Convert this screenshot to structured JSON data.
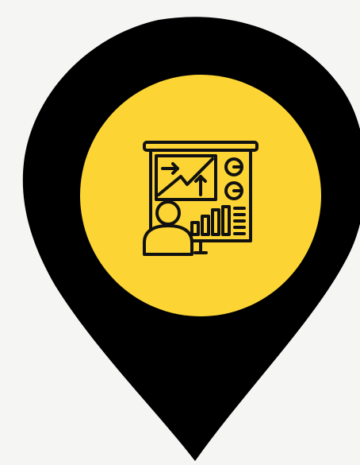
{
  "graphic": {
    "pin_icon": "map-pin-icon",
    "presentation_icon": "presentation-board-icon",
    "colors": {
      "background": "#f5f5f4",
      "pin": "#000000",
      "circle": "#fcd535",
      "icon_stroke": "#111111"
    }
  }
}
